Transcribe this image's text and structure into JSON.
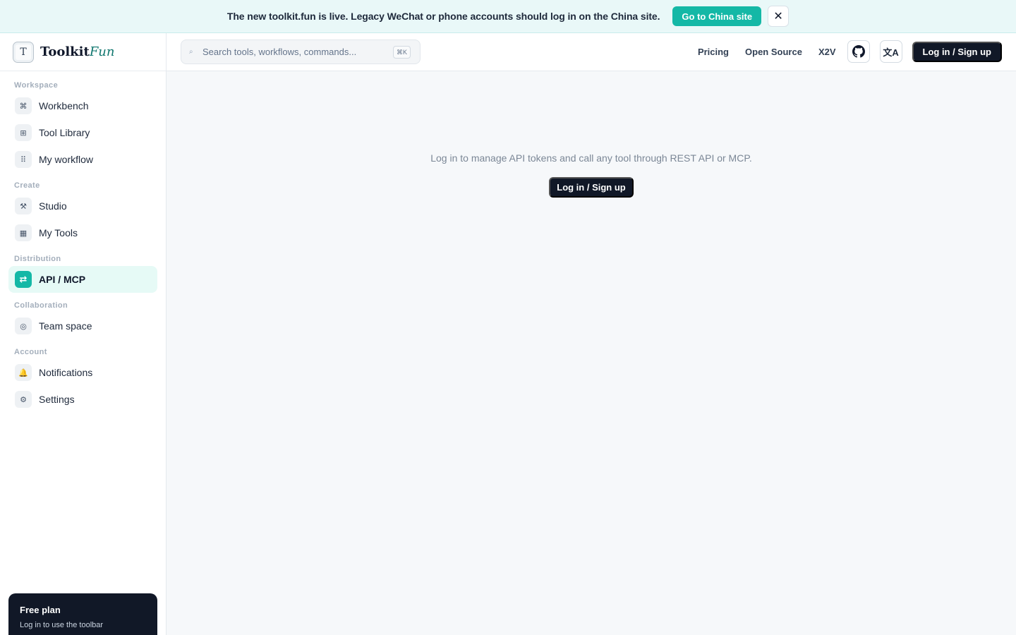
{
  "banner": {
    "message": "The new toolkit.fun is live. Legacy WeChat or phone accounts should log in on the China site.",
    "cta_label": "Go to China site",
    "close_glyph": "✕"
  },
  "brand": {
    "mark": "T",
    "name": "Toolkit",
    "name_accent": "Fun"
  },
  "sidebar": {
    "sections": [
      {
        "label": "Workspace",
        "items": [
          {
            "label": "Workbench",
            "icon": "command-icon",
            "glyph": "⌘"
          },
          {
            "label": "Tool Library",
            "icon": "grid-icon",
            "glyph": "⊞"
          },
          {
            "label": "My workflow",
            "icon": "workflow-icon",
            "glyph": "⠿"
          }
        ]
      },
      {
        "label": "Create",
        "items": [
          {
            "label": "Studio",
            "icon": "hammer-icon",
            "glyph": "⚒"
          },
          {
            "label": "My Tools",
            "icon": "box-icon",
            "glyph": "▦"
          }
        ]
      },
      {
        "label": "Distribution",
        "items": [
          {
            "label": "API / MCP",
            "icon": "swap-icon",
            "glyph": "⇄",
            "active": true
          }
        ]
      },
      {
        "label": "Collaboration",
        "items": [
          {
            "label": "Team space",
            "icon": "team-icon",
            "glyph": "◎"
          }
        ]
      },
      {
        "label": "Account",
        "items": [
          {
            "label": "Notifications",
            "icon": "bell-icon",
            "glyph": "🔔"
          },
          {
            "label": "Settings",
            "icon": "gear-icon",
            "glyph": "⚙"
          }
        ]
      }
    ],
    "plan": {
      "title": "Free plan",
      "subtitle": "Log in to use the toolbar"
    }
  },
  "topbar": {
    "search_placeholder": "Search tools, workflows, commands...",
    "search_shortcut": "⌘K",
    "links": [
      "Pricing",
      "Open Source",
      "X2V"
    ],
    "lang_glyph": "文A",
    "login_label": "Log in / Sign up"
  },
  "main": {
    "message": "Log in to manage API tokens and call any tool through REST API or MCP.",
    "login_label": "Log in / Sign up"
  },
  "colors": {
    "accent": "#14b8a6",
    "dark": "#111827",
    "banner_bg": "#e9f8f8",
    "active_bg": "#e6faf6"
  }
}
